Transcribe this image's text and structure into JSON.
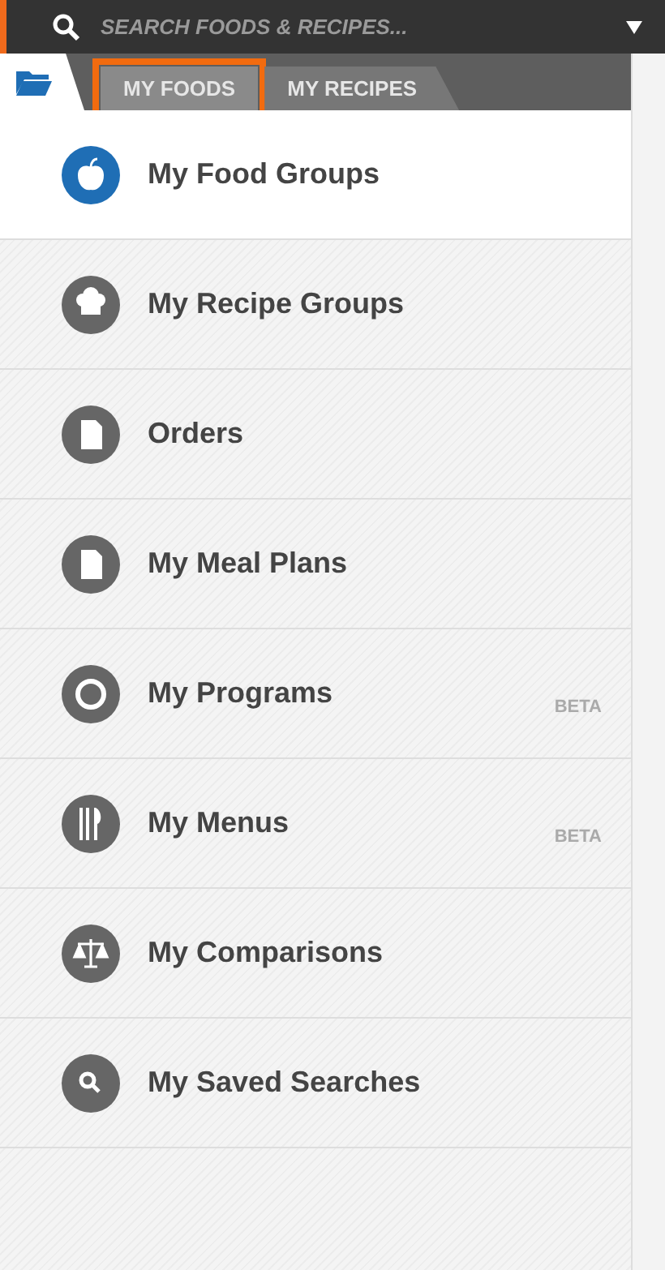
{
  "search": {
    "placeholder": "SEARCH FOODS & RECIPES..."
  },
  "tabs": [
    {
      "label": "MY FOODS",
      "selected": true,
      "highlighted": true
    },
    {
      "label": "MY RECIPES",
      "selected": false,
      "highlighted": false
    }
  ],
  "menu": [
    {
      "label": "My Food Groups",
      "selected": true
    },
    {
      "label": "My Recipe Groups",
      "selected": false
    },
    {
      "label": "Orders",
      "selected": false
    },
    {
      "label": "My Meal Plans",
      "selected": false
    },
    {
      "label": "My Programs",
      "selected": false,
      "badge": "BETA"
    },
    {
      "label": "My Menus",
      "selected": false,
      "badge": "BETA"
    },
    {
      "label": "My Comparisons",
      "selected": false
    },
    {
      "label": "My Saved Searches",
      "selected": false
    }
  ]
}
